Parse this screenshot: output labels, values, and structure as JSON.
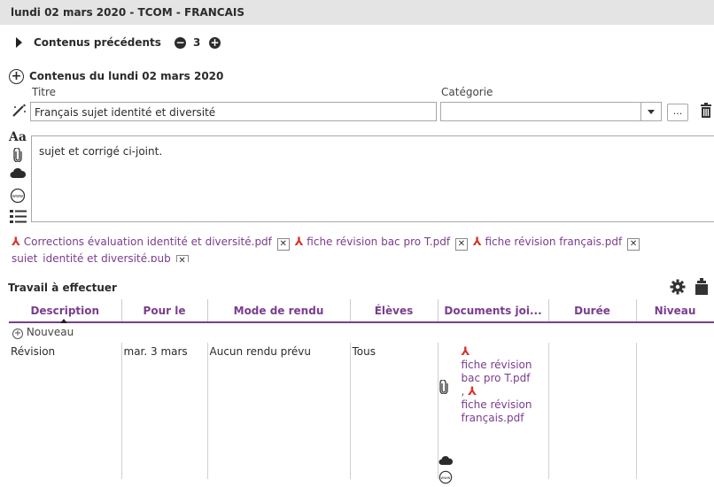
{
  "header": {
    "title": "lundi 02 mars 2020 - TCOM - FRANCAIS"
  },
  "previous": {
    "label": "Contenus précédents",
    "count": "3"
  },
  "contents": {
    "title": "Contenus du lundi 02 mars 2020",
    "titre_label": "Titre",
    "titre_value": "Français sujet identité et diversité",
    "categorie_label": "Catégorie",
    "categorie_value": "",
    "more_label": "...",
    "aa_label": "Aa",
    "body_text": "sujet et corrigé ci-joint."
  },
  "attachments": [
    {
      "name": "Corrections évaluation identité et diversité.pdf"
    },
    {
      "name": "fiche révision bac pro T.pdf"
    },
    {
      "name": "fiche révision français.pdf"
    },
    {
      "name": "sujet_identité et diversité.pub"
    }
  ],
  "work": {
    "title": "Travail à effectuer",
    "columns": [
      "Description",
      "Pour le",
      "Mode de rendu",
      "Élèves",
      "Documents joi...",
      "Durée",
      "Niveau"
    ],
    "new_label": "Nouveau",
    "row": {
      "description": "Révision",
      "pour_le": "mar. 3 mars",
      "mode": "Aucun rendu prévu",
      "eleves": "Tous",
      "doc1": "fiche révision bac pro T.pdf",
      "separator": ",",
      "doc2": "fiche révision français.pdf",
      "duree": "",
      "niveau": ""
    }
  },
  "colors": {
    "accent": "#7a3d8e",
    "pdf": "#d9342b",
    "header_bg": "#e4e4e4"
  }
}
